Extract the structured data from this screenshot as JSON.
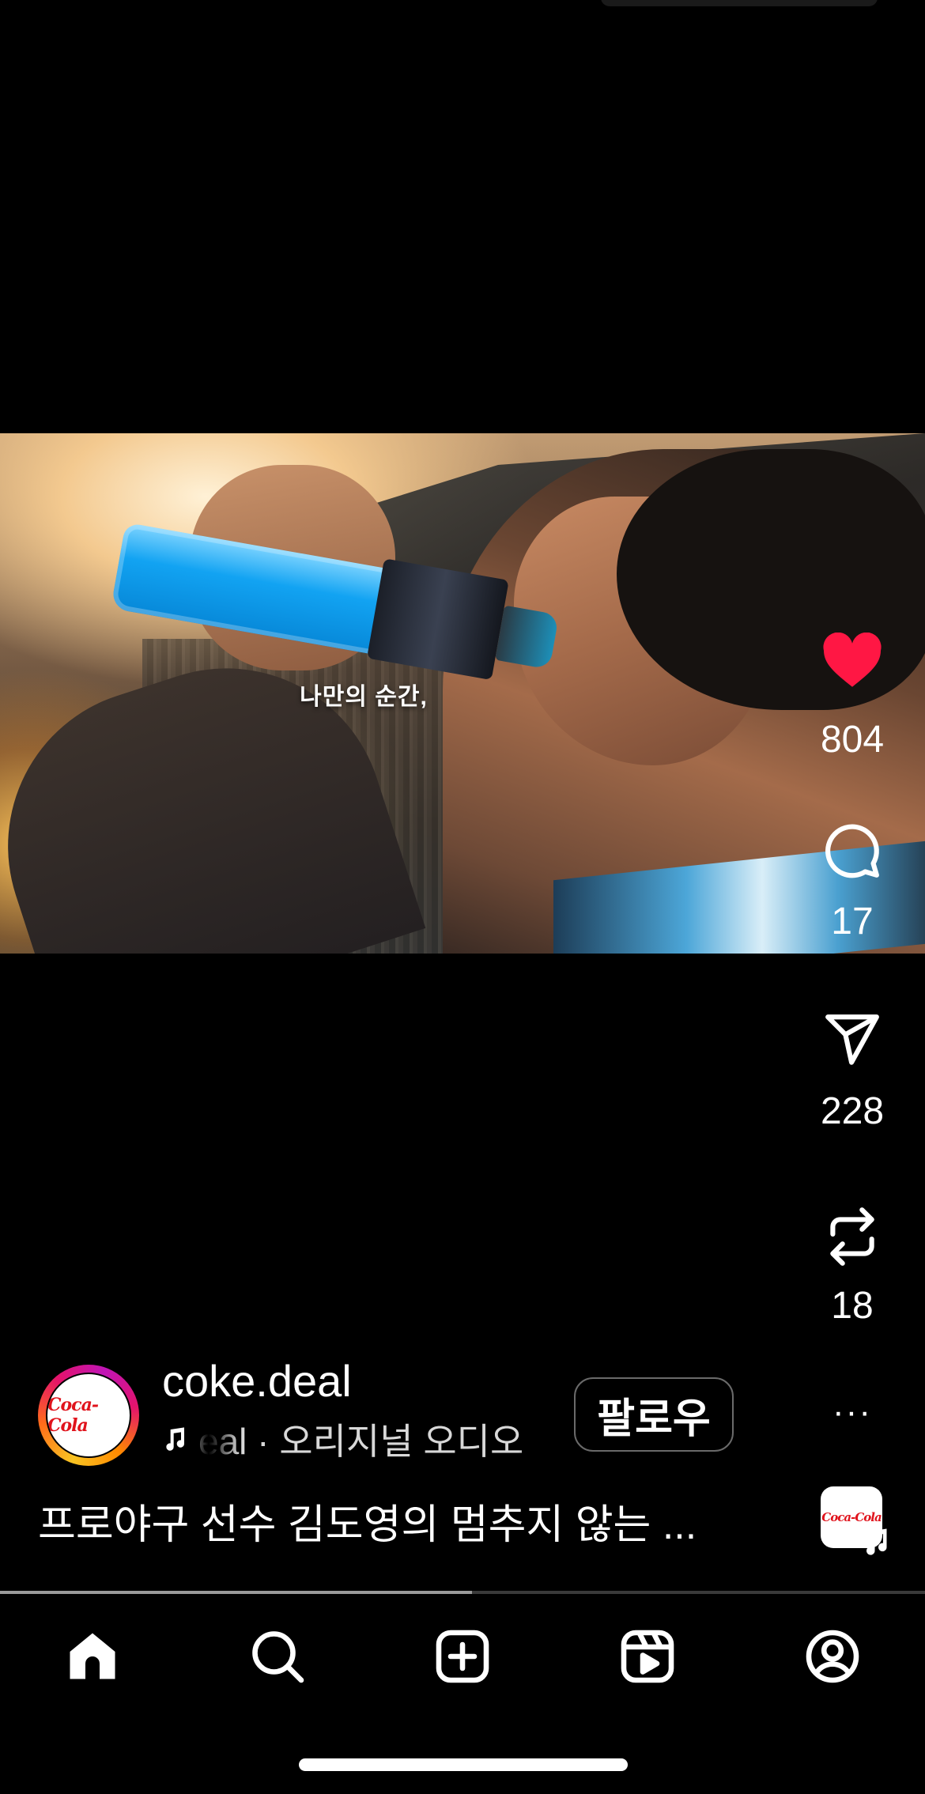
{
  "video": {
    "subtitle": "나만의 순간,"
  },
  "actions": {
    "likes": "804",
    "comments": "17",
    "shares": "228",
    "remixes": "18",
    "like_color": "#ff1744"
  },
  "author": {
    "username": "coke.deal",
    "avatar_logo": "Coca-Cola",
    "audio_label": "eal · 오리지널 오디오",
    "follow_label": "팔로우",
    "more_label": "···"
  },
  "caption": "프로야구 선수 김도영의 멈추지 않는 ...",
  "audio_thumb": {
    "logo": "Coca-Cola"
  },
  "playback": {
    "progress_fraction": 0.51
  },
  "nav": {
    "items": [
      "home-icon",
      "search-icon",
      "create-icon",
      "reels-icon",
      "profile-icon"
    ]
  }
}
